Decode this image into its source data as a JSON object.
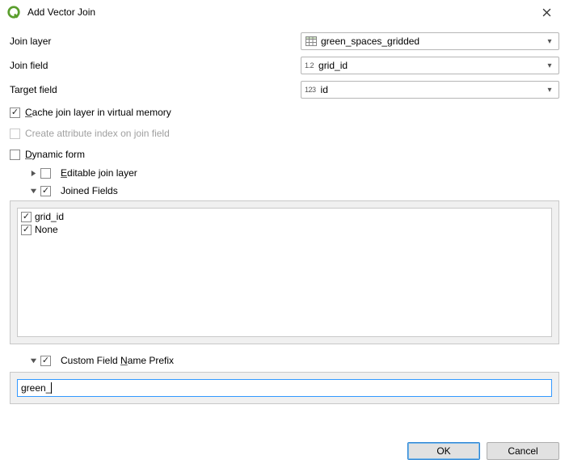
{
  "window": {
    "title": "Add Vector Join"
  },
  "form": {
    "join_layer": {
      "label": "Join layer",
      "value": "green_spaces_gridded"
    },
    "join_field": {
      "label": "Join field",
      "type_hint": "1.2",
      "value": "grid_id"
    },
    "target_field": {
      "label": "Target field",
      "type_hint": "123",
      "value": "id"
    }
  },
  "options": {
    "cache": {
      "label_pre": "C",
      "label_post": "ache join layer in virtual memory",
      "checked": true
    },
    "create_index": {
      "label": "Create attribute index on join field",
      "checked": false,
      "disabled": true
    },
    "dynamic_form": {
      "label_pre": "D",
      "label_post": "ynamic form",
      "checked": false
    },
    "editable": {
      "label_pre": "E",
      "label_post": "ditable join layer",
      "checked": false
    },
    "joined_fields": {
      "label": "Joined Fields",
      "checked": true,
      "expanded": true
    },
    "prefix": {
      "label_pre": "Custom Field ",
      "label_underline": "N",
      "label_post": "ame Prefix",
      "checked": true,
      "expanded": true
    }
  },
  "joined_fields_list": [
    {
      "label": "grid_id",
      "checked": true
    },
    {
      "label": "None",
      "checked": true
    }
  ],
  "prefix_value": "green_",
  "buttons": {
    "ok": "OK",
    "cancel": "Cancel"
  }
}
